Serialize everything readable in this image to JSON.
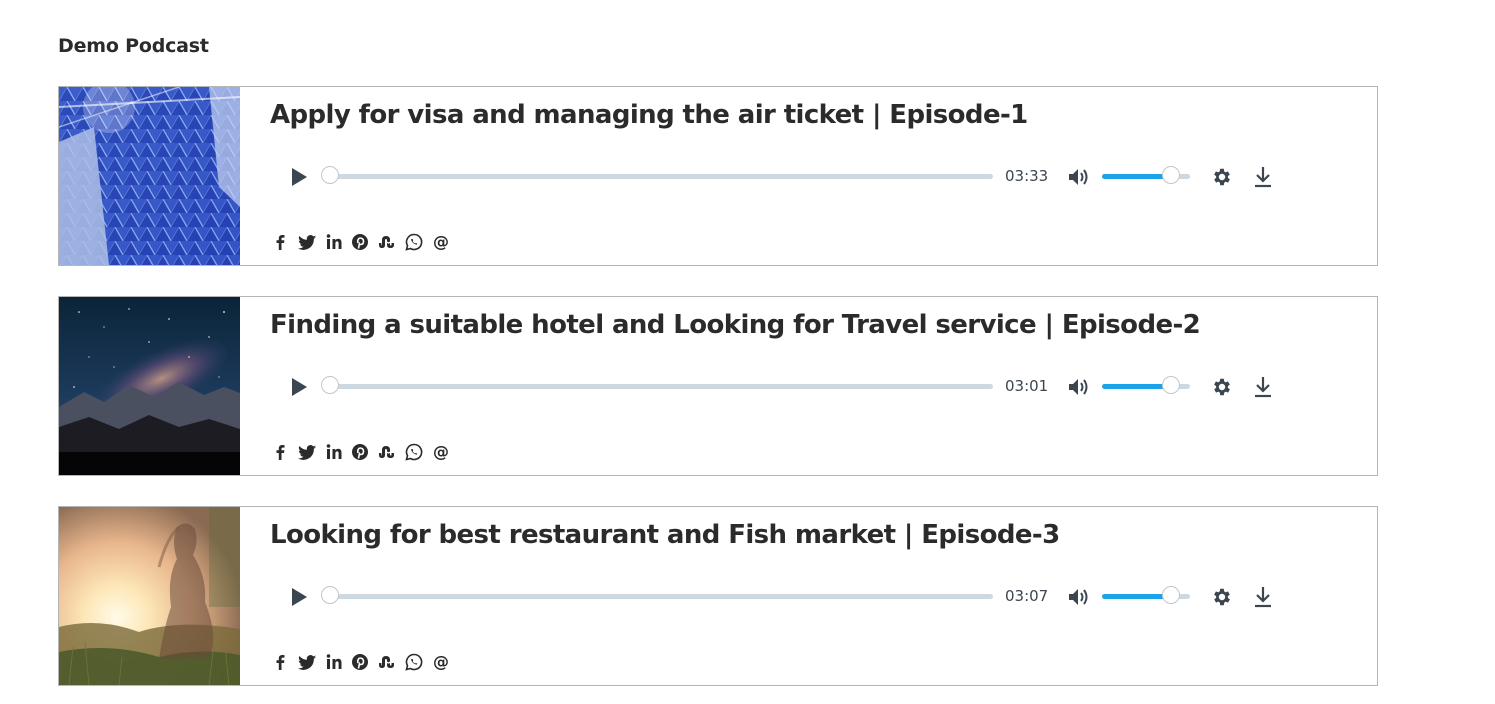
{
  "page": {
    "title": "Demo Podcast"
  },
  "episodes": [
    {
      "title": "Apply for visa and managing the air ticket | Episode-1",
      "duration": "03:33",
      "progress": 0,
      "volume": 0.78,
      "thumbnail": "blue-glass-building"
    },
    {
      "title": "Finding a suitable hotel and Looking for Travel service | Episode-2",
      "duration": "03:01",
      "progress": 0,
      "volume": 0.78,
      "thumbnail": "night-sky-milky-way"
    },
    {
      "title": "Looking for best restaurant and Fish market | Episode-3",
      "duration": "03:07",
      "progress": 0,
      "volume": 0.78,
      "thumbnail": "woman-in-sunset-field"
    }
  ],
  "icons": {
    "play": "play-icon",
    "volume": "volume-icon",
    "settings": "gear-icon",
    "download": "download-icon",
    "social": [
      "facebook-icon",
      "twitter-icon",
      "linkedin-icon",
      "pinterest-icon",
      "stumbleupon-icon",
      "whatsapp-icon",
      "email-icon"
    ]
  },
  "colors": {
    "accent": "#1aa3e8",
    "track": "#ced8e0",
    "icon": "#3c4650",
    "border": "#b5b5b5",
    "text": "#2b2b2b"
  }
}
